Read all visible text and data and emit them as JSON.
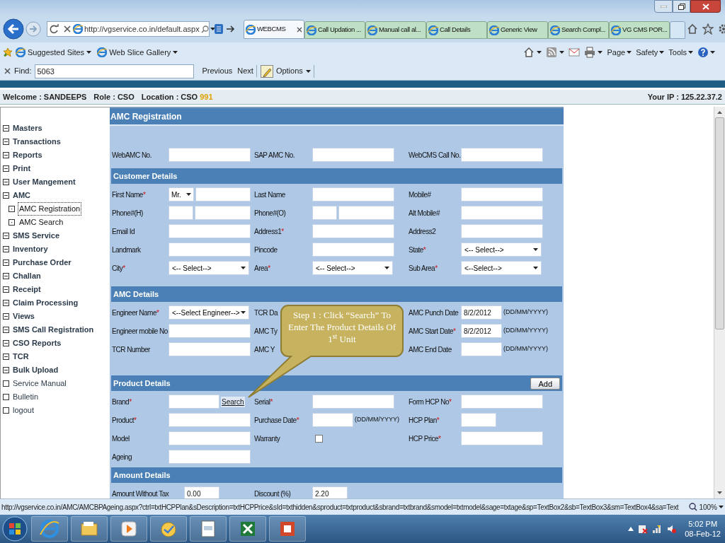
{
  "browser": {
    "address": "http://vgservice.co.in/default.aspx",
    "tabs": [
      {
        "label": "WEBCMS",
        "selected": true
      },
      {
        "label": "Call Updation ...",
        "selected": false
      },
      {
        "label": "Manual call al...",
        "selected": false
      },
      {
        "label": "Call Details",
        "selected": false
      },
      {
        "label": "Generic View",
        "selected": false
      },
      {
        "label": "Search Compl...",
        "selected": false
      },
      {
        "label": "VG CMS POR...",
        "selected": false
      }
    ],
    "favorites": [
      "Suggested Sites",
      "Web Slice Gallery"
    ],
    "commands": [
      "Page",
      "Safety",
      "Tools"
    ],
    "find": {
      "label": "Find:",
      "value": "5063",
      "previous": "Previous",
      "next": "Next",
      "options": "Options"
    }
  },
  "header": {
    "welcome_label": "Welcome :",
    "user": "SANDEEPS",
    "role_label": "Role :",
    "role": "CSO",
    "location_label": "Location :",
    "location": "CSO",
    "location_code": "991",
    "ip_label": "Your IP :",
    "ip": "125.22.37.2"
  },
  "sidebar": {
    "items": [
      {
        "label": "Masters",
        "kind": "group"
      },
      {
        "label": "Transactions",
        "kind": "group"
      },
      {
        "label": "Reports",
        "kind": "group"
      },
      {
        "label": "Print",
        "kind": "group"
      },
      {
        "label": "User Mangement",
        "kind": "group"
      },
      {
        "label": "AMC",
        "kind": "group",
        "children": [
          {
            "label": "AMC Registration",
            "selected": true
          },
          {
            "label": "AMC Search",
            "selected": false
          }
        ]
      },
      {
        "label": "SMS Service",
        "kind": "group"
      },
      {
        "label": "Inventory",
        "kind": "group"
      },
      {
        "label": "Purchase Order",
        "kind": "group"
      },
      {
        "label": "Challan",
        "kind": "group"
      },
      {
        "label": "Receipt",
        "kind": "group"
      },
      {
        "label": "Claim Processing",
        "kind": "group"
      },
      {
        "label": "Views",
        "kind": "group"
      },
      {
        "label": "SMS Call Registration",
        "kind": "group"
      },
      {
        "label": "CSO Reports",
        "kind": "group"
      },
      {
        "label": "TCR",
        "kind": "group"
      },
      {
        "label": "Bulk Upload",
        "kind": "group"
      },
      {
        "label": "Service Manual",
        "kind": "leaf"
      },
      {
        "label": "Bulletin",
        "kind": "leaf"
      },
      {
        "label": "logout",
        "kind": "leaf"
      }
    ]
  },
  "form": {
    "title": "AMC Registration",
    "sections": [
      {
        "rows": [
          [
            {
              "label": "WebAMC No.",
              "kind": "text"
            },
            {
              "label": "SAP AMC No.",
              "kind": "text"
            },
            {
              "label": "WebCMS Call No.",
              "kind": "text"
            }
          ]
        ]
      },
      {
        "title": "Customer Details",
        "rows": [
          [
            {
              "label": "First Name",
              "required_mark": "*",
              "kind": "salutation",
              "value": "Mr."
            },
            {
              "label": "Last Name",
              "kind": "text"
            },
            {
              "label": "Mobile#",
              "kind": "text"
            }
          ],
          [
            {
              "label": "Phone#(H)",
              "kind": "split"
            },
            {
              "label": "Phone#(O)",
              "kind": "split"
            },
            {
              "label": "Alt Mobile#",
              "kind": "text"
            }
          ],
          [
            {
              "label": "Email Id",
              "kind": "text"
            },
            {
              "label": "Address1",
              "required_mark": "*",
              "kind": "text"
            },
            {
              "label": "Address2",
              "kind": "text"
            }
          ],
          [
            {
              "label": "Landmark",
              "kind": "text"
            },
            {
              "label": "Pincode",
              "kind": "text"
            },
            {
              "label": "State",
              "required_mark": "*",
              "kind": "select",
              "value": "<-- Select-->"
            }
          ],
          [
            {
              "label": "City",
              "required_mark": "*",
              "kind": "select",
              "value": "<-- Select-->"
            },
            {
              "label": "Area",
              "required_mark": "*",
              "kind": "select",
              "value": "<-- Select-->"
            },
            {
              "label": "Sub Area",
              "required_mark": "*",
              "kind": "select",
              "value": "<--Select-->"
            }
          ]
        ]
      },
      {
        "title": "AMC Details",
        "rows": [
          [
            {
              "label": "Engineer Name",
              "required_mark": "*",
              "kind": "select",
              "value": "<--Select Engineer-->"
            },
            {
              "label": "TCR Da",
              "kind": "label"
            },
            {
              "label": "AMC Punch Date",
              "kind": "date",
              "value": "8/2/2012",
              "suffix": "(DD/MM/YYYY)"
            }
          ],
          [
            {
              "label": "Engineer mobile No",
              "kind": "text"
            },
            {
              "label": "AMC Ty",
              "kind": "label"
            },
            {
              "label": "AMC Start Date",
              "required_mark": "*",
              "kind": "date",
              "value": "8/2/2012",
              "suffix": "(DD/MM/YYYY)"
            }
          ],
          [
            {
              "label": "TCR Number",
              "kind": "text"
            },
            {
              "label": "AMC Y",
              "kind": "label"
            },
            {
              "label": "AMC End Date",
              "kind": "date",
              "suffix": "(DD/MM/YYYY)"
            }
          ]
        ]
      },
      {
        "title": "Product Details",
        "action": "Add",
        "rows": [
          [
            {
              "label": "Brand",
              "required_mark": "*",
              "kind": "text",
              "link": "Search"
            },
            {
              "label": "Serial",
              "required_mark": "*",
              "kind": "text"
            },
            {
              "label": "Form HCP No",
              "required_mark": "*",
              "kind": "text"
            }
          ],
          [
            {
              "label": "Product",
              "required_mark": "*",
              "kind": "text"
            },
            {
              "label": "Purchase Date",
              "required_mark": "*",
              "kind": "date",
              "suffix": "(DD/MM/YYYY)"
            },
            {
              "label": "HCP Plan",
              "required_mark": "*",
              "kind": "short"
            }
          ],
          [
            {
              "label": "Model",
              "kind": "text"
            },
            {
              "label": "Warranty",
              "kind": "checkbox",
              "checked": false
            },
            {
              "label": "HCP Price",
              "required_mark": "*",
              "kind": "text"
            }
          ],
          [
            {
              "label": "Ageing",
              "kind": "text"
            }
          ]
        ]
      },
      {
        "title": "Amount Details",
        "rows": [
          [
            {
              "label": "Amount Without Tax",
              "kind": "short",
              "value": "0.00"
            },
            {
              "label": "Discount (%)",
              "kind": "short",
              "value": "2.20"
            }
          ]
        ]
      }
    ]
  },
  "callout": "Step  1 : Click “Search” To Enter The Product Details Of 1$^{st}$ Unit",
  "status_bar": {
    "url": "http://vgservice.co.in/AMC/AMCBPAgeing.aspx?ctrl=txtHCPPlan&sDescription=txtHCPPrice&sId=txthidden&sproduct=txtproduct&sbrand=txtbrand&smodel=txtmodel&sage=txtage&sp=TextBox2&sb=TextBox3&sm=TextBox4&sa=Text",
    "zoom": "100%"
  },
  "taskbar": {
    "time": "5:02 PM",
    "date": "08-Feb-12"
  }
}
